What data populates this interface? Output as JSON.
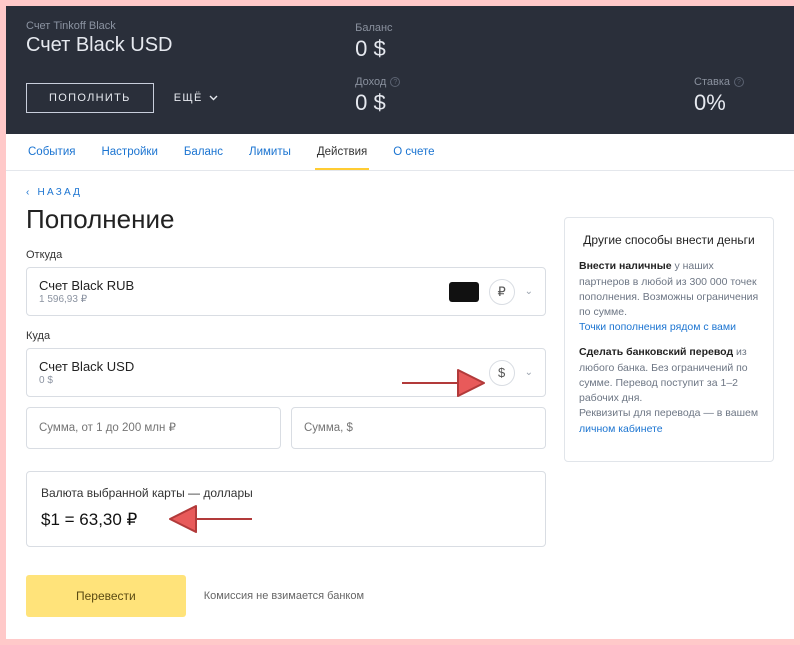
{
  "header": {
    "subtitle": "Счет Tinkoff Black",
    "title": "Счет Black USD",
    "buttons": {
      "topup": "ПОПОЛНИТЬ",
      "more": "ЕЩЁ"
    },
    "stats": {
      "balance_label": "Баланс",
      "balance_value": "0 $",
      "income_label": "Доход",
      "income_value": "0 $",
      "rate_label": "Ставка",
      "rate_value": "0%"
    }
  },
  "tabs": [
    "События",
    "Настройки",
    "Баланс",
    "Лимиты",
    "Действия",
    "О счете"
  ],
  "active_tab_index": 4,
  "back": "НАЗАД",
  "page_title": "Пополнение",
  "from": {
    "label": "Откуда",
    "account": "Счет Black RUB",
    "balance": "1 596,93 ₽",
    "currency_symbol": "₽"
  },
  "to": {
    "label": "Куда",
    "account": "Счет Black USD",
    "balance": "0 $",
    "currency_symbol": "$"
  },
  "inputs": {
    "amount_rub": "Сумма, от 1 до 200 млн ₽",
    "amount_usd": "Сумма, $"
  },
  "rate": {
    "label": "Валюта выбранной карты — доллары",
    "value": "$1 = 63,30 ₽"
  },
  "submit": "Перевести",
  "fee_note": "Комиссия не взимается банком",
  "side": {
    "title": "Другие способы внести деньги",
    "cash_bold": "Внести наличные",
    "cash_text": " у наших партнеров в любой из 300 000 точек пополнения. Возможны ограничения по сумме.",
    "cash_link": "Точки пополнения рядом с вами",
    "wire_bold": "Сделать банковский перевод",
    "wire_text": " из любого банка. Без ограничений по сумме. Перевод поступит за 1–2 рабочих дня.",
    "wire_text2": "Реквизиты для перевода — в вашем ",
    "wire_link": "личном кабинете"
  }
}
